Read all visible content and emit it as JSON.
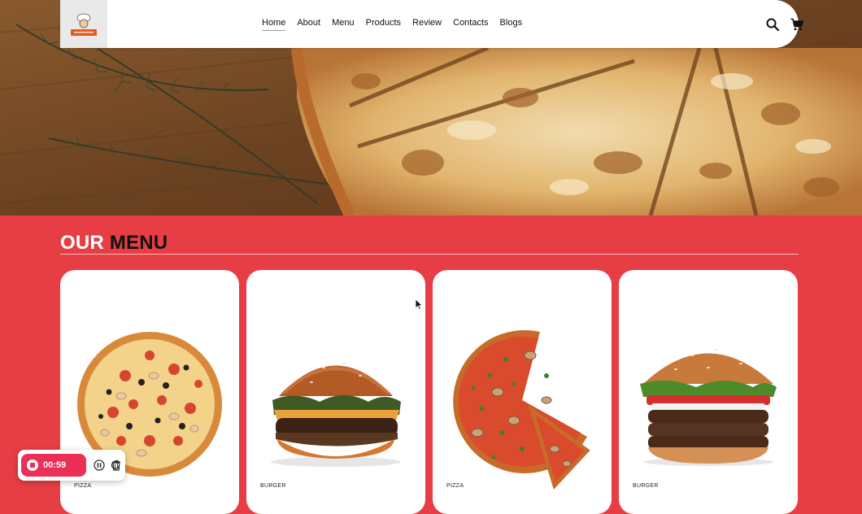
{
  "nav": {
    "links": [
      {
        "label": "Home",
        "active": true
      },
      {
        "label": "About"
      },
      {
        "label": "Menu"
      },
      {
        "label": "Products"
      },
      {
        "label": "Review"
      },
      {
        "label": "Contacts"
      },
      {
        "label": "Blogs"
      }
    ],
    "icons": [
      "search-icon",
      "cart-icon"
    ]
  },
  "menu": {
    "title_word1": "OUR",
    "title_word2": "MENU",
    "items": [
      {
        "category": "PIZZA",
        "image": "pizza-image"
      },
      {
        "category": "BURGER",
        "image": "burger-image"
      },
      {
        "category": "PIZZA",
        "image": "pizza-slice-image"
      },
      {
        "category": "BURGER",
        "image": "triple-burger-image"
      }
    ]
  },
  "recorder": {
    "time": "00:59",
    "controls": [
      "pause-icon",
      "restart-icon",
      "trash-icon"
    ]
  },
  "colors": {
    "accent": "#e63e44",
    "recorder": "#ec2f57"
  }
}
